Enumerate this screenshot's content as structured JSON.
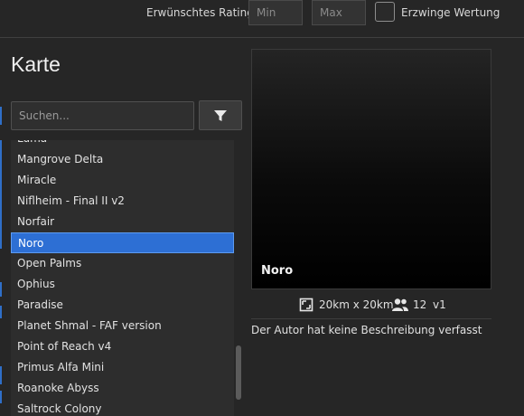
{
  "rating": {
    "label": "Erwünschtes Rating",
    "min_placeholder": "Min",
    "max_placeholder": "Max",
    "enforce_label": "Erzwinge Wertung",
    "enforce_checked": false
  },
  "map_panel": {
    "title": "Karte",
    "search_placeholder": "Suchen...",
    "filter_icon": "filter-icon",
    "items": [
      "Luma",
      "Mangrove Delta",
      "Miracle",
      "Niflheim - Final II v2",
      "Norfair",
      "Noro",
      "Open Palms",
      "Ophius",
      "Paradise",
      "Planet Shmal - FAF version",
      "Point of Reach v4",
      "Primus Alfa Mini",
      "Roanoke Abyss",
      "Saltrock Colony"
    ],
    "selected": "Noro"
  },
  "preview": {
    "map_name": "Noro",
    "size_icon": "map-size-icon",
    "size": "20km x 20km",
    "players_icon": "players-icon",
    "players": "12",
    "version": "v1",
    "description": "Der Autor hat keine Beschreibung verfasst"
  },
  "colors": {
    "background": "#262626",
    "selection": "#2d6fd4",
    "accent": "#2f6fc8"
  }
}
